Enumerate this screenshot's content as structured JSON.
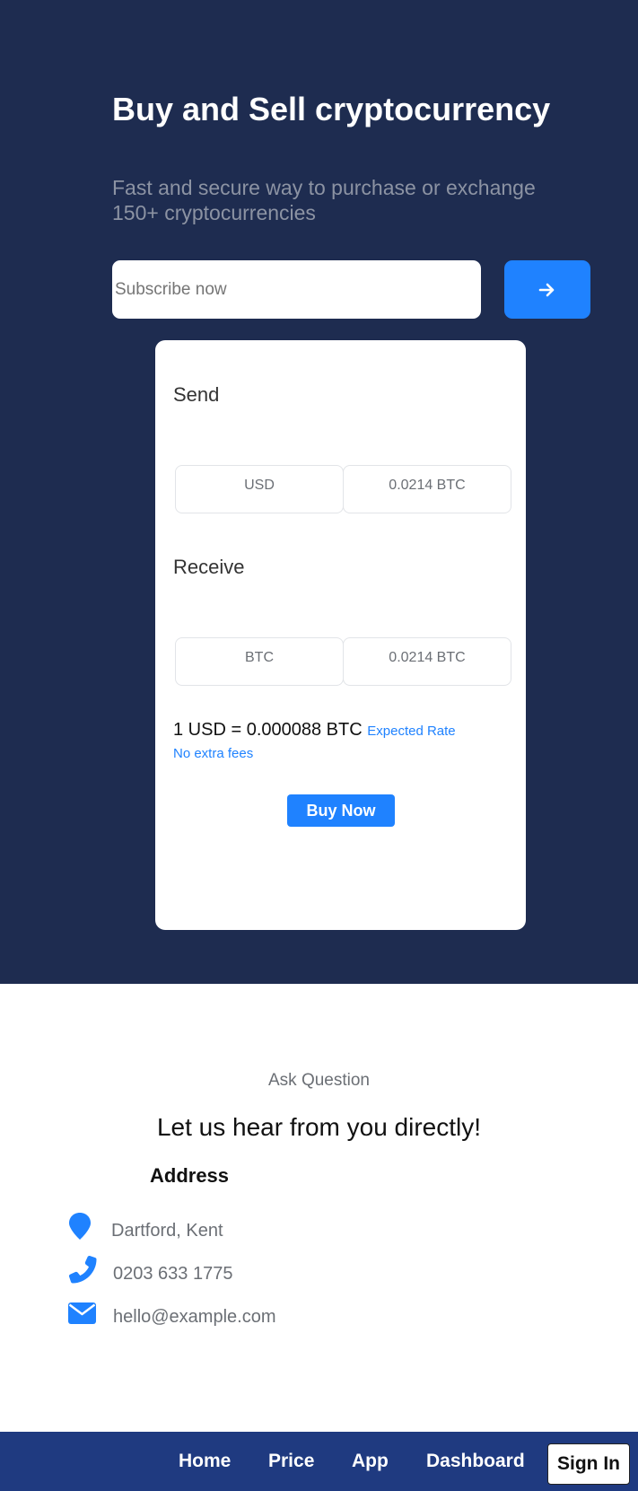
{
  "hero": {
    "title": "Buy and Sell cryptocurrency",
    "subtitle": "Fast and secure way to purchase or exchange 150+ cryptocurrencies",
    "subscribe_placeholder": "Subscribe now",
    "subscribe_button_icon": "arrow-right-icon"
  },
  "exchange": {
    "send_label": "Send",
    "send_currency": "USD",
    "send_amount": "0.0214 BTC",
    "receive_label": "Receive",
    "receive_currency": "BTC",
    "receive_amount": "0.0214 BTC",
    "rate": "1 USD = 0.000088 BTC",
    "rate_note": "Expected Rate",
    "fees_note": "No extra fees",
    "buy_button": "Buy Now"
  },
  "contact": {
    "eyebrow": "Ask Question",
    "heading": "Let us hear from you directly!",
    "address_title": "Address",
    "items": [
      {
        "icon": "map-pin-icon",
        "text": "Dartford, Kent"
      },
      {
        "icon": "phone-icon",
        "text": "0203 633 1775"
      },
      {
        "icon": "envelope-icon",
        "text": "hello@example.com"
      }
    ]
  },
  "nav": {
    "links": [
      "Home",
      "Price",
      "App",
      "Dashboard"
    ],
    "signin": "Sign In"
  },
  "colors": {
    "hero_bg": "#1e2c50",
    "accent": "#1f82ff",
    "navbar_bg": "#1f3a80"
  }
}
